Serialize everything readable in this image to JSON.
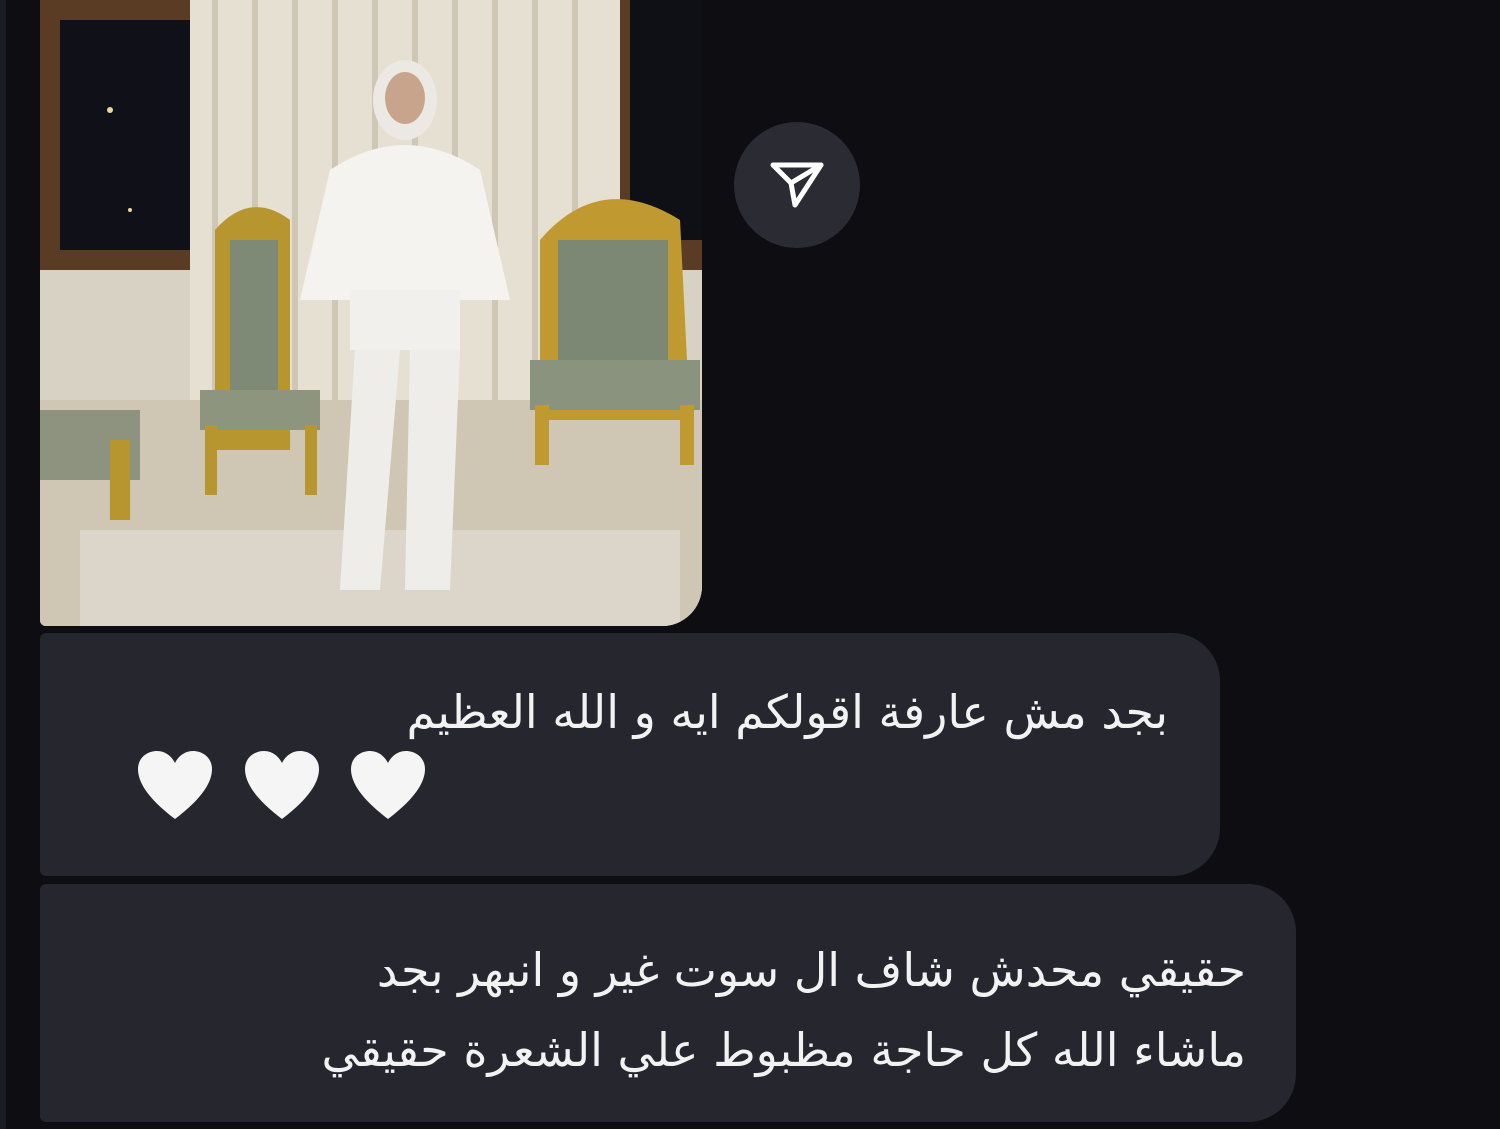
{
  "share_button": {
    "icon": "send-icon"
  },
  "messages": [
    {
      "lines": [
        "بجد مش عارفة اقولكم ايه و الله العظيم"
      ],
      "emojis": [
        "🤍",
        "🤍",
        "🤍"
      ]
    },
    {
      "lines": [
        "حقيقي محدش شاف ال سوت غير و انبهر بجد",
        "ماشاء الله كل حاجة مظبوط علي الشعرة حقيقي"
      ]
    }
  ],
  "colors": {
    "background": "#0d0d12",
    "bubble": "#26272e",
    "text": "#f2f2f2",
    "share_button": "#2a2b33"
  }
}
